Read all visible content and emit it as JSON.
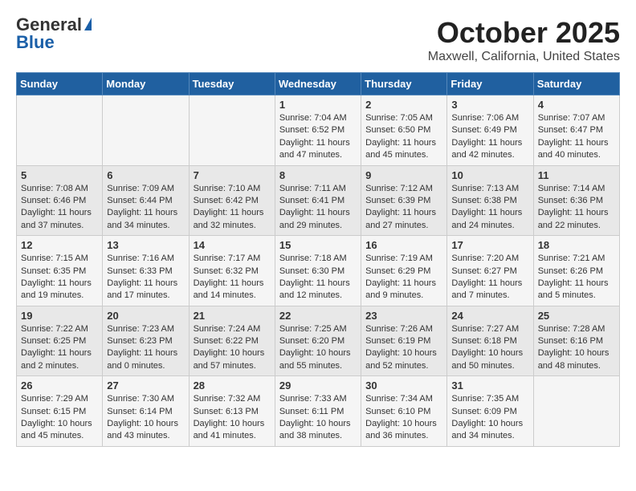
{
  "logo": {
    "general": "General",
    "blue": "Blue"
  },
  "title": "October 2025",
  "subtitle": "Maxwell, California, United States",
  "headers": [
    "Sunday",
    "Monday",
    "Tuesday",
    "Wednesday",
    "Thursday",
    "Friday",
    "Saturday"
  ],
  "rows": [
    [
      {
        "day": "",
        "content": ""
      },
      {
        "day": "",
        "content": ""
      },
      {
        "day": "",
        "content": ""
      },
      {
        "day": "1",
        "content": "Sunrise: 7:04 AM\nSunset: 6:52 PM\nDaylight: 11 hours and 47 minutes."
      },
      {
        "day": "2",
        "content": "Sunrise: 7:05 AM\nSunset: 6:50 PM\nDaylight: 11 hours and 45 minutes."
      },
      {
        "day": "3",
        "content": "Sunrise: 7:06 AM\nSunset: 6:49 PM\nDaylight: 11 hours and 42 minutes."
      },
      {
        "day": "4",
        "content": "Sunrise: 7:07 AM\nSunset: 6:47 PM\nDaylight: 11 hours and 40 minutes."
      }
    ],
    [
      {
        "day": "5",
        "content": "Sunrise: 7:08 AM\nSunset: 6:46 PM\nDaylight: 11 hours and 37 minutes."
      },
      {
        "day": "6",
        "content": "Sunrise: 7:09 AM\nSunset: 6:44 PM\nDaylight: 11 hours and 34 minutes."
      },
      {
        "day": "7",
        "content": "Sunrise: 7:10 AM\nSunset: 6:42 PM\nDaylight: 11 hours and 32 minutes."
      },
      {
        "day": "8",
        "content": "Sunrise: 7:11 AM\nSunset: 6:41 PM\nDaylight: 11 hours and 29 minutes."
      },
      {
        "day": "9",
        "content": "Sunrise: 7:12 AM\nSunset: 6:39 PM\nDaylight: 11 hours and 27 minutes."
      },
      {
        "day": "10",
        "content": "Sunrise: 7:13 AM\nSunset: 6:38 PM\nDaylight: 11 hours and 24 minutes."
      },
      {
        "day": "11",
        "content": "Sunrise: 7:14 AM\nSunset: 6:36 PM\nDaylight: 11 hours and 22 minutes."
      }
    ],
    [
      {
        "day": "12",
        "content": "Sunrise: 7:15 AM\nSunset: 6:35 PM\nDaylight: 11 hours and 19 minutes."
      },
      {
        "day": "13",
        "content": "Sunrise: 7:16 AM\nSunset: 6:33 PM\nDaylight: 11 hours and 17 minutes."
      },
      {
        "day": "14",
        "content": "Sunrise: 7:17 AM\nSunset: 6:32 PM\nDaylight: 11 hours and 14 minutes."
      },
      {
        "day": "15",
        "content": "Sunrise: 7:18 AM\nSunset: 6:30 PM\nDaylight: 11 hours and 12 minutes."
      },
      {
        "day": "16",
        "content": "Sunrise: 7:19 AM\nSunset: 6:29 PM\nDaylight: 11 hours and 9 minutes."
      },
      {
        "day": "17",
        "content": "Sunrise: 7:20 AM\nSunset: 6:27 PM\nDaylight: 11 hours and 7 minutes."
      },
      {
        "day": "18",
        "content": "Sunrise: 7:21 AM\nSunset: 6:26 PM\nDaylight: 11 hours and 5 minutes."
      }
    ],
    [
      {
        "day": "19",
        "content": "Sunrise: 7:22 AM\nSunset: 6:25 PM\nDaylight: 11 hours and 2 minutes."
      },
      {
        "day": "20",
        "content": "Sunrise: 7:23 AM\nSunset: 6:23 PM\nDaylight: 11 hours and 0 minutes."
      },
      {
        "day": "21",
        "content": "Sunrise: 7:24 AM\nSunset: 6:22 PM\nDaylight: 10 hours and 57 minutes."
      },
      {
        "day": "22",
        "content": "Sunrise: 7:25 AM\nSunset: 6:20 PM\nDaylight: 10 hours and 55 minutes."
      },
      {
        "day": "23",
        "content": "Sunrise: 7:26 AM\nSunset: 6:19 PM\nDaylight: 10 hours and 52 minutes."
      },
      {
        "day": "24",
        "content": "Sunrise: 7:27 AM\nSunset: 6:18 PM\nDaylight: 10 hours and 50 minutes."
      },
      {
        "day": "25",
        "content": "Sunrise: 7:28 AM\nSunset: 6:16 PM\nDaylight: 10 hours and 48 minutes."
      }
    ],
    [
      {
        "day": "26",
        "content": "Sunrise: 7:29 AM\nSunset: 6:15 PM\nDaylight: 10 hours and 45 minutes."
      },
      {
        "day": "27",
        "content": "Sunrise: 7:30 AM\nSunset: 6:14 PM\nDaylight: 10 hours and 43 minutes."
      },
      {
        "day": "28",
        "content": "Sunrise: 7:32 AM\nSunset: 6:13 PM\nDaylight: 10 hours and 41 minutes."
      },
      {
        "day": "29",
        "content": "Sunrise: 7:33 AM\nSunset: 6:11 PM\nDaylight: 10 hours and 38 minutes."
      },
      {
        "day": "30",
        "content": "Sunrise: 7:34 AM\nSunset: 6:10 PM\nDaylight: 10 hours and 36 minutes."
      },
      {
        "day": "31",
        "content": "Sunrise: 7:35 AM\nSunset: 6:09 PM\nDaylight: 10 hours and 34 minutes."
      },
      {
        "day": "",
        "content": ""
      }
    ]
  ]
}
